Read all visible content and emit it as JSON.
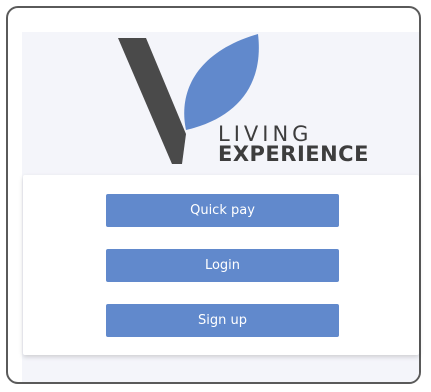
{
  "brand": {
    "line1": "LIVING",
    "line2": "EXPERIENCE",
    "accent_color": "#6189cc",
    "dark_color": "#4a4a4a"
  },
  "actions": {
    "quick_pay": "Quick pay",
    "login": "Login",
    "sign_up": "Sign up"
  }
}
